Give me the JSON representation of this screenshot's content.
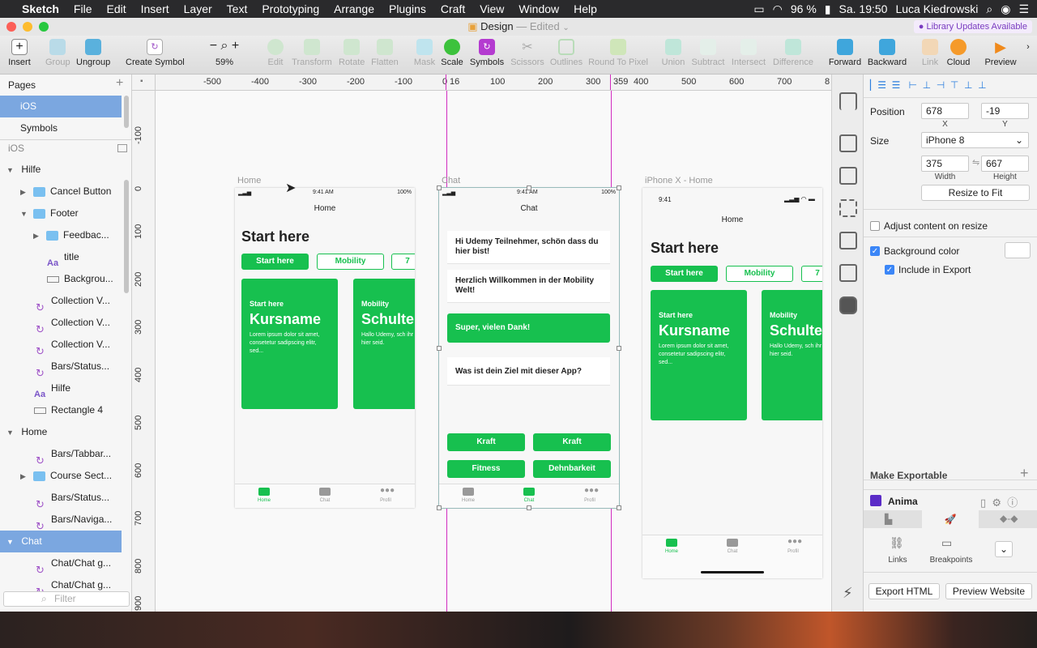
{
  "menubar": {
    "app": "Sketch",
    "items": [
      "File",
      "Edit",
      "Insert",
      "Layer",
      "Text",
      "Prototyping",
      "Arrange",
      "Plugins",
      "Craft",
      "View",
      "Window",
      "Help"
    ],
    "battery": "96 %",
    "clock": "Sa. 19:50",
    "user": "Luca Kiedrowski"
  },
  "window": {
    "title": "Design",
    "edited": "— Edited",
    "library_notice": "Library Updates Available"
  },
  "toolbar": {
    "insert": "Insert",
    "group": "Group",
    "ungroup": "Ungroup",
    "create_symbol": "Create Symbol",
    "zoom": "59%",
    "edit": "Edit",
    "transform": "Transform",
    "rotate": "Rotate",
    "flatten": "Flatten",
    "mask": "Mask",
    "scale": "Scale",
    "symbols": "Symbols",
    "scissors": "Scissors",
    "outlines": "Outlines",
    "round_to_pixel": "Round To Pixel",
    "union": "Union",
    "subtract": "Subtract",
    "intersect": "Intersect",
    "difference": "Difference",
    "forward": "Forward",
    "backward": "Backward",
    "link": "Link",
    "cloud": "Cloud",
    "preview": "Preview"
  },
  "pages": {
    "header": "Pages",
    "items": [
      "iOS",
      "Symbols"
    ],
    "current_page": "iOS",
    "filter_placeholder": "Filter"
  },
  "layers": [
    "Hilfe",
    "Cancel Button",
    "Footer",
    "Feedbac...",
    "title",
    "Backgrou...",
    "Collection V...",
    "Collection V...",
    "Collection V...",
    "Bars/Status...",
    "Hilfe",
    "Rectangle 4",
    "Home",
    "Bars/Tabbar...",
    "Course Sect...",
    "Bars/Status...",
    "Bars/Naviga...",
    "Chat",
    "Chat/Chat g...",
    "Chat/Chat g..."
  ],
  "hruler": [
    "-500",
    "-400",
    "-300",
    "-200",
    "-100",
    "0",
    "16",
    "100",
    "200",
    "300",
    "359",
    "400",
    "500",
    "600",
    "700",
    "8"
  ],
  "vruler": [
    "-100",
    "0",
    "100",
    "200",
    "300",
    "400",
    "500",
    "600",
    "700",
    "800",
    "900"
  ],
  "artboards": {
    "home": {
      "label": "Home",
      "time": "9:41 AM",
      "battery": "100%",
      "nav_title": "Home",
      "heading": "Start here",
      "chips": [
        "Start here",
        "Mobility",
        "7"
      ],
      "cards": [
        {
          "kicker": "Start here",
          "title": "Kursname",
          "desc": "Lorem ipsum dolor sit amet, consetetur sadipscing elitr, sed..."
        },
        {
          "kicker": "Mobility",
          "title": "Schulte",
          "desc": "Hallo Udemy, sch ihr hier seid."
        }
      ],
      "tabs": [
        "Home",
        "Chat",
        "Profil"
      ]
    },
    "chat": {
      "label": "Chat",
      "time": "9:41 AM",
      "battery": "100%",
      "nav_title": "Chat",
      "messages": [
        "Hi Udemy Teilnehmer, schön dass du hier bist!",
        "Herzlich Willkommen in der Mobility Welt!",
        "Super, vielen Dank!",
        "Was ist dein Ziel mit dieser App?"
      ],
      "answers": [
        "Kraft",
        "Kraft",
        "Fitness",
        "Dehnbarkeit"
      ],
      "tabs": [
        "Home",
        "Chat",
        "Profil"
      ]
    },
    "iphonex": {
      "label": "iPhone X - Home",
      "time": "9:41",
      "nav_title": "Home",
      "heading": "Start here",
      "chips": [
        "Start here",
        "Mobility",
        "7"
      ],
      "cards": [
        {
          "kicker": "Start here",
          "title": "Kursname",
          "desc": "Lorem ipsum dolor sit amet, consetetur sadipscing elitr, sed..."
        },
        {
          "kicker": "Mobility",
          "title": "Schulte",
          "desc": "Hallo Udemy, sch ihr hier seid."
        }
      ],
      "tabs": [
        "Home",
        "Chat",
        "Profil"
      ]
    }
  },
  "inspector": {
    "position_label": "Position",
    "x": "678",
    "y": "-19",
    "x_label": "X",
    "y_label": "Y",
    "size_label": "Size",
    "size_preset": "iPhone 8",
    "width": "375",
    "height": "667",
    "width_label": "Width",
    "height_label": "Height",
    "resize_to_fit": "Resize to Fit",
    "adjust_content": "Adjust content on resize",
    "background_color": "Background color",
    "include_in_export": "Include in Export",
    "make_exportable": "Make Exportable",
    "anima": "Anima",
    "links": "Links",
    "breakpoints": "Breakpoints",
    "export_html": "Export HTML",
    "preview_website": "Preview Website"
  }
}
